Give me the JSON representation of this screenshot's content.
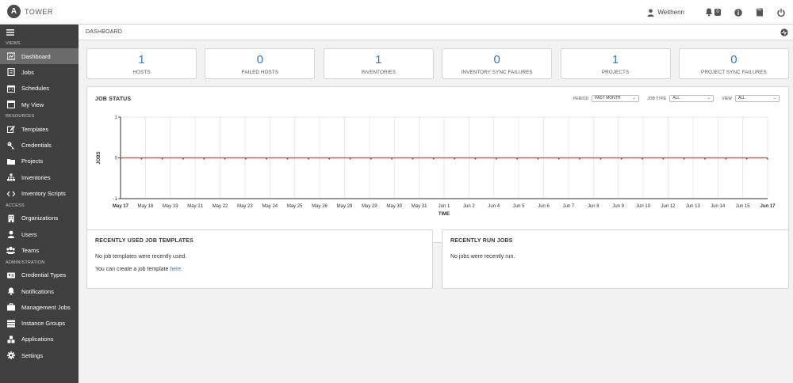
{
  "app": {
    "brand_letter": "A",
    "brand_name": "TOWER",
    "username": "Weithenn",
    "notification_count": "0"
  },
  "sidebar": {
    "sections": [
      {
        "label": "VIEWS",
        "items": [
          {
            "label": "Dashboard",
            "icon": "dashboard-icon",
            "active": true
          },
          {
            "label": "Jobs",
            "icon": "jobs-icon"
          },
          {
            "label": "Schedules",
            "icon": "calendar-icon"
          },
          {
            "label": "My View",
            "icon": "my-view-icon"
          }
        ]
      },
      {
        "label": "RESOURCES",
        "items": [
          {
            "label": "Templates",
            "icon": "pencil-icon"
          },
          {
            "label": "Credentials",
            "icon": "key-icon"
          },
          {
            "label": "Projects",
            "icon": "folder-icon"
          },
          {
            "label": "Inventories",
            "icon": "sitemap-icon"
          },
          {
            "label": "Inventory Scripts",
            "icon": "code-icon"
          }
        ]
      },
      {
        "label": "ACCESS",
        "items": [
          {
            "label": "Organizations",
            "icon": "building-icon"
          },
          {
            "label": "Users",
            "icon": "user-icon"
          },
          {
            "label": "Teams",
            "icon": "users-icon"
          }
        ]
      },
      {
        "label": "ADMINISTRATION",
        "items": [
          {
            "label": "Credential Types",
            "icon": "id-card-icon"
          },
          {
            "label": "Notifications",
            "icon": "bell-icon"
          },
          {
            "label": "Management Jobs",
            "icon": "briefcase-icon"
          },
          {
            "label": "Instance Groups",
            "icon": "server-icon"
          },
          {
            "label": "Applications",
            "icon": "cubes-icon"
          },
          {
            "label": "Settings",
            "icon": "gear-icon"
          }
        ]
      }
    ]
  },
  "breadcrumb": "DASHBOARD",
  "counts": [
    {
      "value": "1",
      "label": "HOSTS"
    },
    {
      "value": "0",
      "label": "FAILED HOSTS"
    },
    {
      "value": "1",
      "label": "INVENTORIES"
    },
    {
      "value": "0",
      "label": "INVENTORY SYNC FAILURES"
    },
    {
      "value": "1",
      "label": "PROJECTS"
    },
    {
      "value": "0",
      "label": "PROJECT SYNC FAILURES"
    }
  ],
  "job_status": {
    "title": "JOB STATUS",
    "filters": {
      "period_label": "PERIOD",
      "period_value": "PAST MONTH",
      "job_type_label": "JOB TYPE",
      "job_type_value": "ALL",
      "view_label": "VIEW",
      "view_value": "ALL"
    }
  },
  "chart_data": {
    "type": "line",
    "title": "",
    "xlabel": "TIME",
    "ylabel": "JOBS",
    "ylim": [
      -1,
      1
    ],
    "yticks": [
      "1",
      "0",
      "-1"
    ],
    "categories": [
      "May 17",
      "May 18",
      "May 19",
      "May 21",
      "May 22",
      "May 23",
      "May 24",
      "May 25",
      "May 26",
      "May 28",
      "May 29",
      "May 30",
      "May 31",
      "Jun 1",
      "Jun 2",
      "Jun 4",
      "Jun 5",
      "Jun 6",
      "Jun 7",
      "Jun 8",
      "Jun 9",
      "Jun 10",
      "Jun 12",
      "Jun 13",
      "Jun 14",
      "Jun 15",
      "Jun 17"
    ],
    "series": [
      {
        "values": [
          0,
          0,
          0,
          0,
          0,
          0,
          0,
          0,
          0,
          0,
          0,
          0,
          0,
          0,
          0,
          0,
          0,
          0,
          0,
          0,
          0,
          0,
          0,
          0,
          0,
          0,
          0,
          0,
          0,
          0,
          0,
          0
        ],
        "color": "#d9534f"
      }
    ],
    "grid": true,
    "colors": {
      "line": "#d9534f",
      "grid": "#e3e3e3",
      "axis": "#333333"
    }
  },
  "templates_panel": {
    "title": "RECENTLY USED JOB TEMPLATES",
    "empty_text": "No job templates were recently used.",
    "create_prefix": "You can create a job template ",
    "create_link": "here",
    "create_suffix": "."
  },
  "recent_jobs_panel": {
    "title": "RECENTLY RUN JOBS",
    "empty_text": "No jobs were recently run."
  }
}
